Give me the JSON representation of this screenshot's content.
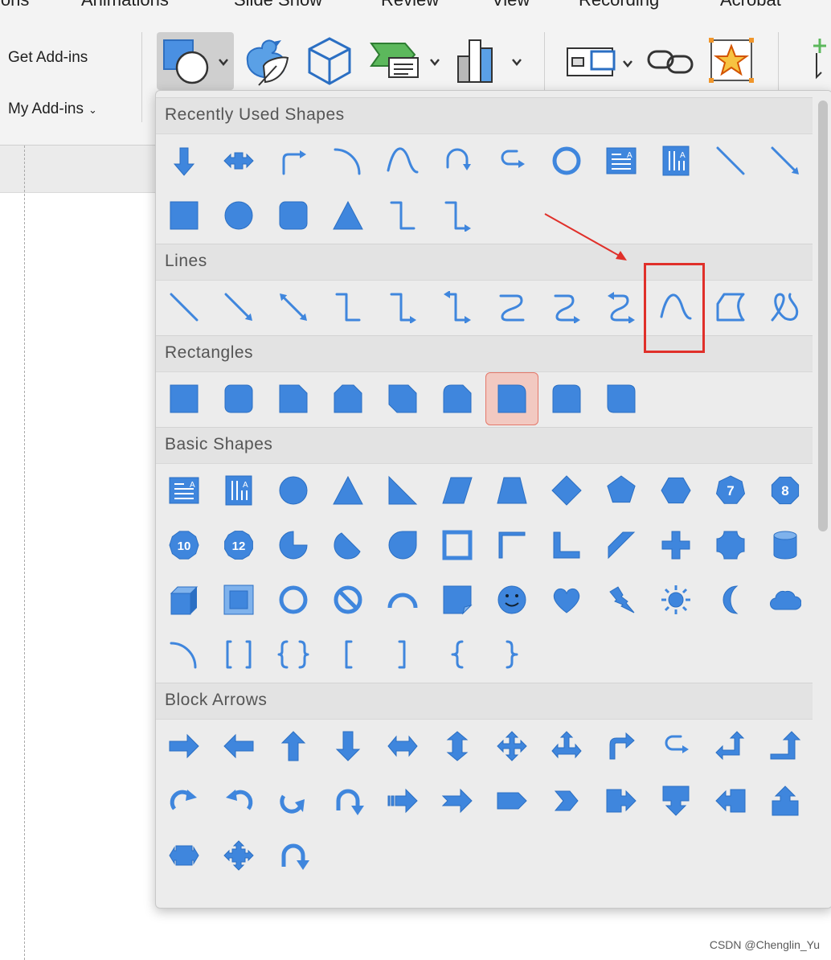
{
  "menubar": {
    "items": [
      "ions",
      "Animations",
      "Slide Show",
      "Review",
      "View",
      "Recording",
      "Acrobat"
    ]
  },
  "ribbon": {
    "addins": {
      "get_label": "Get Add-ins",
      "my_label": "My Add-ins"
    },
    "buttons": [
      {
        "name": "shapes-button",
        "icon": "shapes-icon",
        "dropdown": true,
        "active": true
      },
      {
        "name": "icons-button",
        "icon": "duck-leaf-icon"
      },
      {
        "name": "3d-models-button",
        "icon": "cube-icon"
      },
      {
        "name": "smartart-button",
        "icon": "smartart-icon",
        "dropdown": true
      },
      {
        "name": "chart-button",
        "icon": "bar-chart-icon",
        "dropdown": true
      },
      {
        "name": "screenshot-button",
        "icon": "screenshot-icon",
        "dropdown": true
      },
      {
        "name": "link-button",
        "icon": "link-icon"
      },
      {
        "name": "action-button",
        "icon": "star-frame-icon"
      },
      {
        "name": "comment-button",
        "icon": "new-comment-icon"
      }
    ]
  },
  "colors": {
    "accent": "#3f86dd",
    "accent_dark": "#2b6fc3",
    "highlight": "#e0302a",
    "selected_bg": "#f2c9c1",
    "selected_border": "#e4786a"
  },
  "panel": {
    "sections": [
      {
        "title": "Recently Used Shapes",
        "shapes": [
          "arrow-down",
          "arrow-left-right-block",
          "bent-arrow-right",
          "arc",
          "curve",
          "curved-arrow",
          "u-turn-arrow",
          "donut",
          "text-box",
          "vertical-text-box",
          "line",
          "line-arrow",
          "rectangle",
          "oval",
          "rounded-rectangle",
          "triangle",
          "elbow-connector",
          "elbow-arrow-connector"
        ]
      },
      {
        "title": "Lines",
        "shapes": [
          "line",
          "line-arrow",
          "line-double-arrow",
          "elbow-connector",
          "elbow-arrow-connector",
          "elbow-double-arrow-connector",
          "curved-connector",
          "curved-arrow-connector",
          "curved-double-arrow-connector",
          "curve",
          "freeform-shape",
          "scribble"
        ]
      },
      {
        "title": "Rectangles",
        "shapes": [
          "rectangle",
          "rounded-rectangle",
          "snip-single-corner",
          "snip-same-side",
          "snip-diagonal",
          "snip-round-single",
          "round-single-corner",
          "round-same-side",
          "round-diagonal"
        ]
      },
      {
        "title": "Basic Shapes",
        "shapes": [
          "text-box",
          "vertical-text-box",
          "oval",
          "isosceles-triangle",
          "right-triangle",
          "parallelogram",
          "trapezoid",
          "diamond",
          "pentagon",
          "hexagon",
          "heptagon",
          "octagon",
          "decagon",
          "dodecagon",
          "pie",
          "chord",
          "teardrop",
          "frame",
          "half-frame",
          "l-shape",
          "diagonal-stripe",
          "cross",
          "plaque",
          "can",
          "cube",
          "bevel",
          "donut",
          "no-symbol",
          "block-arc",
          "folded-corner",
          "smiley-face",
          "heart",
          "lightning-bolt",
          "sun",
          "moon",
          "cloud",
          "arc",
          "double-bracket",
          "double-brace",
          "left-bracket",
          "right-bracket",
          "left-brace",
          "right-brace"
        ]
      },
      {
        "title": "Block Arrows",
        "shapes": [
          "right-arrow",
          "left-arrow",
          "up-arrow",
          "down-arrow",
          "left-right-arrow",
          "up-down-arrow",
          "quad-arrow",
          "left-right-up-arrow",
          "bent-arrow",
          "u-turn-arrow",
          "left-up-arrow",
          "bent-up-arrow",
          "curved-right-arrow",
          "curved-left-arrow",
          "curved-up-arrow",
          "curved-down-arrow",
          "striped-right-arrow",
          "notched-right-arrow",
          "pentagon-arrow",
          "chevron",
          "right-arrow-callout",
          "down-arrow-callout",
          "left-arrow-callout",
          "up-arrow-callout",
          "left-right-arrow-callout",
          "quad-arrow-callout",
          "circular-arrow"
        ]
      }
    ],
    "shape_labels": {
      "heptagon": "7",
      "octagon": "8",
      "decagon": "10",
      "dodecagon": "12"
    },
    "selected": {
      "section": 2,
      "index": 6
    },
    "highlighted": {
      "section": 1,
      "index": 9
    }
  },
  "watermark": "CSDN @Chenglin_Yu"
}
